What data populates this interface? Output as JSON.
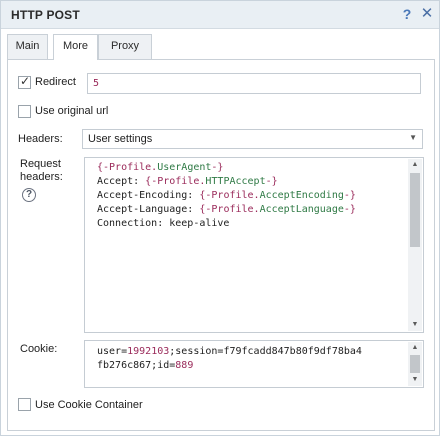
{
  "window": {
    "title": "HTTP POST",
    "help_glyph": "?",
    "close_glyph": "✕"
  },
  "tabs": [
    {
      "label": "Main",
      "active": false
    },
    {
      "label": "More",
      "active": true
    },
    {
      "label": "Proxy",
      "active": false
    }
  ],
  "redirect": {
    "label": "Redirect",
    "checked": true,
    "value": "5"
  },
  "use_original_url": {
    "label": "Use original url",
    "checked": false
  },
  "headers": {
    "label": "Headers:",
    "selected": "User settings",
    "dropdown_icon": "chevron-down-icon"
  },
  "request_headers": {
    "label_line1": "Request",
    "label_line2": "headers:",
    "help_glyph": "?",
    "lines": [
      {
        "prefix": "",
        "var_open": "{-Profile.",
        "prop": "UserAgent",
        "var_close": "-}"
      },
      {
        "prefix": "Accept: ",
        "var_open": "{-Profile.",
        "prop": "HTTPAccept",
        "var_close": "-}"
      },
      {
        "prefix": "Accept-Encoding: ",
        "var_open": "{-Profile.",
        "prop": "AcceptEncoding",
        "var_close": "-}"
      },
      {
        "prefix": "Accept-Language: ",
        "var_open": "{-Profile.",
        "prop": "AcceptLanguage",
        "var_close": "-}"
      },
      {
        "prefix": "Connection: keep-alive",
        "var_open": "",
        "prop": "",
        "var_close": ""
      }
    ]
  },
  "cookie": {
    "label": "Cookie:",
    "line1_a": "user=",
    "line1_num": "1992103",
    "line1_b": ";session=f79fcadd847b80f9df78ba4",
    "line2_a": "fb276c867;id=",
    "line2_num": "889"
  },
  "use_cookie_container": {
    "label": "Use Cookie Container",
    "checked": false
  },
  "colors": {
    "accent": "#4a78b8",
    "variable": "#9a2a5a",
    "property": "#2f7a45"
  }
}
